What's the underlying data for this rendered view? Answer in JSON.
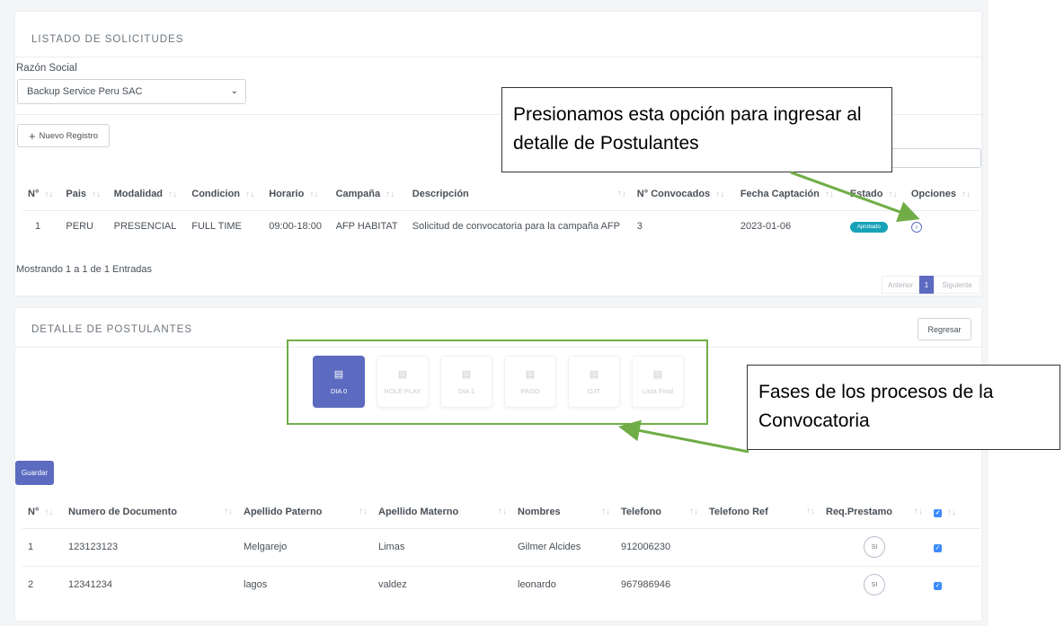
{
  "listado": {
    "title": "LISTADO DE SOLICITUDES",
    "razon_label": "Razón Social",
    "razon_value": "Backup Service Peru SAC",
    "nuevo_button": "Nuevo Registro",
    "columns": [
      "N°",
      "Pais",
      "Modalidad",
      "Condicion",
      "Horario",
      "Campaña",
      "Descripción",
      "N° Convocados",
      "Fecha Captación",
      "Estado",
      "Opciones"
    ],
    "rows": [
      {
        "n": "1",
        "pais": "PERU",
        "modalidad": "PRESENCIAL",
        "condicion": "FULL TIME",
        "horario": "09:00-18:00",
        "campana": "AFP HABITAT",
        "descripcion": "Solicitud de convocatoria para la campaña AFP",
        "convocados": "3",
        "fecha": "2023-01-06",
        "estado": "Aprobado"
      }
    ],
    "info": "Mostrando 1 a 1 de 1 Entradas",
    "pager": {
      "prev": "Anterior",
      "page": "1",
      "next": "Siguiente"
    }
  },
  "detalle": {
    "title": "DETALLE DE POSTULANTES",
    "regresar_button": "Regresar",
    "phases": [
      "DIA 0",
      "ROLE PLAY",
      "DIA 1",
      "PAGO",
      "OJT",
      "Lista Final"
    ],
    "guardar_button": "Guardar",
    "columns": [
      "N°",
      "Numero de Documento",
      "Apellido Paterno",
      "Apellido Materno",
      "Nombres",
      "Telefono",
      "Telefono Ref",
      "Req.Prestamo"
    ],
    "rows": [
      {
        "n": "1",
        "documento": "123123123",
        "paterno": "Melgarejo",
        "materno": "Limas",
        "nombres": "Gilmer Alcides",
        "telefono": "912006230",
        "telefono_ref": "",
        "prestamo": "SI"
      },
      {
        "n": "2",
        "documento": "12341234",
        "paterno": "lagos",
        "materno": "valdez",
        "nombres": "leonardo",
        "telefono": "967986946",
        "telefono_ref": "",
        "prestamo": "SI"
      }
    ]
  },
  "callouts": {
    "opciones": "Presionamos esta opción para ingresar al detalle de Postulantes",
    "fases": "Fases de los procesos de la Convocatoria"
  },
  "colors": {
    "primary": "#5c6bc0",
    "badge": "#17a2b8",
    "checkbox": "#3d8bfd",
    "annotation": "#70ad47"
  }
}
